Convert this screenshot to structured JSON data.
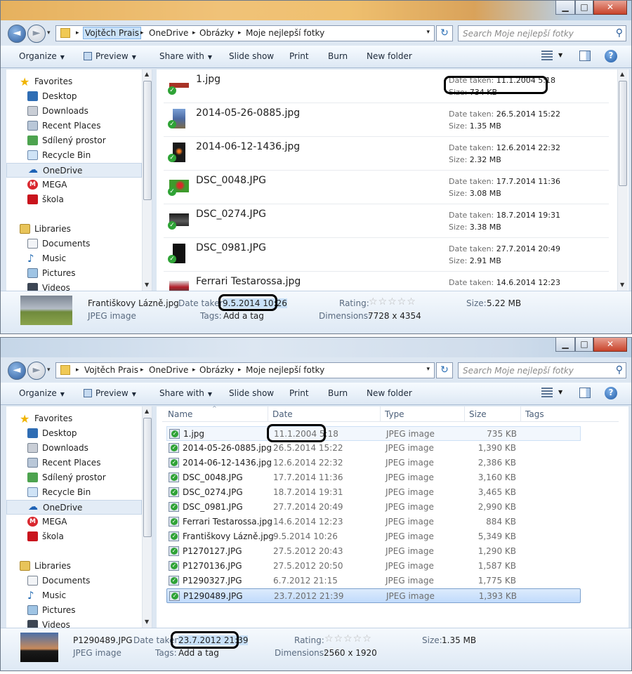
{
  "window_controls": {
    "minimize": "▁",
    "maximize": "□",
    "close": "✕"
  },
  "nav": {
    "back": "◄",
    "forward": "►",
    "history": "▾",
    "address_dropdown": "▾",
    "refresh": "↻"
  },
  "breadcrumbs": [
    "Vojtěch Prais",
    "OneDrive",
    "Obrázky",
    "Moje nejlepší fotky"
  ],
  "search": {
    "placeholder": "Search Moje nejlepší fotky",
    "icon": "search-icon"
  },
  "toolbar": {
    "organize": "Organize",
    "preview": "Preview",
    "share_with": "Share with",
    "slide_show": "Slide show",
    "print": "Print",
    "burn": "Burn",
    "new_folder": "New folder"
  },
  "sidebar": {
    "favorites_label": "Favorites",
    "favorites": [
      "Desktop",
      "Downloads",
      "Recent Places",
      "Sdílený prostor",
      "Recycle Bin",
      "OneDrive",
      "MEGA",
      "škola"
    ],
    "libraries_label": "Libraries",
    "libraries": [
      "Documents",
      "Music",
      "Pictures",
      "Videos"
    ]
  },
  "labels": {
    "date_taken": "Date taken:",
    "size": "Size:",
    "rating": "Rating:",
    "tags": "Tags:",
    "dimensions": "Dimensions:",
    "add_tag": "Add a tag",
    "stars": "☆☆☆☆☆",
    "sort_indicator": "^"
  },
  "tiles": [
    {
      "name": "1.jpg",
      "date": "11.1.2004 5:18",
      "size": "734 KB",
      "thumb": "#a83226"
    },
    {
      "name": "2014-05-26-0885.jpg",
      "date": "26.5.2014 15:22",
      "size": "1.35 MB",
      "thumb": "#4c6aa2"
    },
    {
      "name": "2014-06-12-1436.jpg",
      "date": "12.6.2014 22:32",
      "size": "2.32 MB",
      "thumb": "#1a1a1a"
    },
    {
      "name": "DSC_0048.JPG",
      "date": "17.7.2014 11:36",
      "size": "3.08 MB",
      "thumb": "#3e9a2c"
    },
    {
      "name": "DSC_0274.JPG",
      "date": "18.7.2014 19:31",
      "size": "3.38 MB",
      "thumb": "#2b2b2b"
    },
    {
      "name": "DSC_0981.JPG",
      "date": "27.7.2014 20:49",
      "size": "2.91 MB",
      "thumb": "#111111"
    },
    {
      "name": "Ferrari Testarossa.jpg",
      "date": "14.6.2014 12:23",
      "size": "",
      "thumb": "#b2202a"
    }
  ],
  "details1": {
    "name": "Františkovy Lázně.jpg",
    "type": "JPEG image",
    "date": "9.5.2014 10:26",
    "size": "5.22 MB",
    "dimensions": "7728 x 4354"
  },
  "columns": {
    "name": "Name",
    "date": "Date",
    "type": "Type",
    "size": "Size",
    "tags": "Tags"
  },
  "rows": [
    {
      "name": "1.jpg",
      "date": "11.1.2004 5:18",
      "type": "JPEG image",
      "size": "735 KB"
    },
    {
      "name": "2014-05-26-0885.jpg",
      "date": "26.5.2014 15:22",
      "type": "JPEG image",
      "size": "1,390 KB"
    },
    {
      "name": "2014-06-12-1436.jpg",
      "date": "12.6.2014 22:32",
      "type": "JPEG image",
      "size": "2,386 KB"
    },
    {
      "name": "DSC_0048.JPG",
      "date": "17.7.2014 11:36",
      "type": "JPEG image",
      "size": "3,160 KB"
    },
    {
      "name": "DSC_0274.JPG",
      "date": "18.7.2014 19:31",
      "type": "JPEG image",
      "size": "3,465 KB"
    },
    {
      "name": "DSC_0981.JPG",
      "date": "27.7.2014 20:49",
      "type": "JPEG image",
      "size": "2,990 KB"
    },
    {
      "name": "Ferrari Testarossa.jpg",
      "date": "14.6.2014 12:23",
      "type": "JPEG image",
      "size": "884 KB"
    },
    {
      "name": "Františkovy Lázně.jpg",
      "date": "9.5.2014 10:26",
      "type": "JPEG image",
      "size": "5,349 KB"
    },
    {
      "name": "P1270127.JPG",
      "date": "27.5.2012 20:43",
      "type": "JPEG image",
      "size": "1,290 KB"
    },
    {
      "name": "P1270136.JPG",
      "date": "27.5.2012 20:50",
      "type": "JPEG image",
      "size": "1,587 KB"
    },
    {
      "name": "P1290327.JPG",
      "date": "6.7.2012 21:15",
      "type": "JPEG image",
      "size": "1,775 KB"
    },
    {
      "name": "P1290489.JPG",
      "date": "23.7.2012 21:39",
      "type": "JPEG image",
      "size": "1,393 KB"
    }
  ],
  "details2": {
    "name": "P1290489.JPG",
    "type": "JPEG image",
    "date": "23.7.2012 21:39",
    "size": "1.35 MB",
    "dimensions": "2560 x 1920"
  },
  "colors": {
    "accent": "#3399ff",
    "selection": "#c1dbfc",
    "sync_check": "#2fa336",
    "highlight_ring": "#000000"
  }
}
